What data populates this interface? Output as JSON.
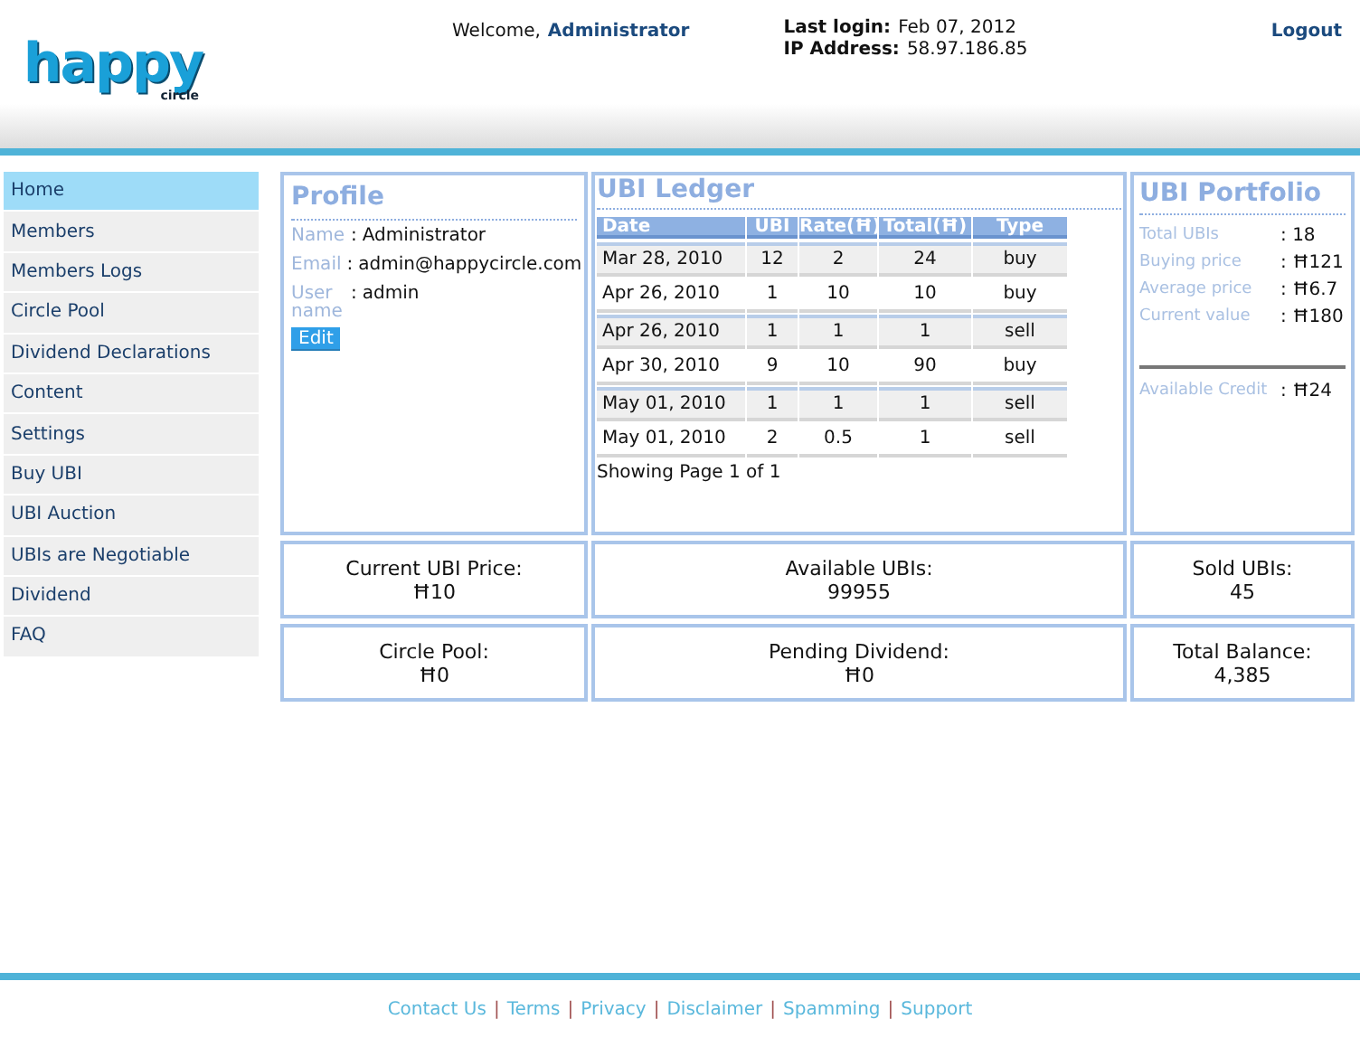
{
  "logo": {
    "main": "happy",
    "sub": "circle"
  },
  "header": {
    "welcome_label": "Welcome,",
    "user": "Administrator",
    "last_login_label": "Last login:",
    "last_login": "Feb 07, 2012",
    "ip_label": "IP Address:",
    "ip": "58.97.186.85",
    "logout": "Logout"
  },
  "sidebar": {
    "items": [
      {
        "label": "Home",
        "selected": true
      },
      {
        "label": "Members",
        "selected": false
      },
      {
        "label": "Members Logs",
        "selected": false
      },
      {
        "label": "Circle Pool",
        "selected": false
      },
      {
        "label": "Dividend Declarations",
        "selected": false
      },
      {
        "label": "Content",
        "selected": false
      },
      {
        "label": "Settings",
        "selected": false
      },
      {
        "label": "Buy UBI",
        "selected": false
      },
      {
        "label": "UBI Auction",
        "selected": false
      },
      {
        "label": "UBIs are Negotiable",
        "selected": false
      },
      {
        "label": "Dividend",
        "selected": false
      },
      {
        "label": "FAQ",
        "selected": false
      }
    ]
  },
  "profile": {
    "title": "Profile",
    "fields": [
      {
        "label": "Name",
        "value": "Administrator"
      },
      {
        "label": "Email",
        "value": "admin@happycircle.com"
      },
      {
        "label": "User name",
        "value": "admin"
      }
    ],
    "separator": ":",
    "edit_button": "Edit"
  },
  "ledger": {
    "title": "UBI Ledger",
    "columns": [
      "Date",
      "UBI",
      "Rate(Ħ)",
      "Total(Ħ)",
      "Type"
    ],
    "rows": [
      [
        "Mar 28, 2010",
        "12",
        "2",
        "24",
        "buy"
      ],
      [
        "Apr 26, 2010",
        "1",
        "10",
        "10",
        "buy"
      ],
      [
        "Apr 26, 2010",
        "1",
        "1",
        "1",
        "sell"
      ],
      [
        "Apr 30, 2010",
        "9",
        "10",
        "90",
        "buy"
      ],
      [
        "May 01, 2010",
        "1",
        "1",
        "1",
        "sell"
      ],
      [
        "May 01, 2010",
        "2",
        "0.5",
        "1",
        "sell"
      ]
    ],
    "pager": "Showing Page 1 of 1"
  },
  "portfolio": {
    "title": "UBI Portfolio",
    "separator": ":",
    "items": [
      {
        "label": "Total UBIs",
        "value": "18"
      },
      {
        "label": "Buying price",
        "value": "Ħ121"
      },
      {
        "label": "Average price",
        "value": "Ħ6.7"
      },
      {
        "label": "Current value",
        "value": "Ħ180"
      }
    ],
    "credit": {
      "label": "Available Credit",
      "value": "Ħ24"
    }
  },
  "stats": [
    {
      "label": "Current UBI Price:",
      "value": "Ħ10"
    },
    {
      "label": "Available UBIs:",
      "value": "99955"
    },
    {
      "label": "Sold UBIs:",
      "value": "45"
    },
    {
      "label": "Circle Pool:",
      "value": "Ħ0"
    },
    {
      "label": "Pending Dividend:",
      "value": "Ħ0"
    },
    {
      "label": "Total Balance:",
      "value": "4,385"
    }
  ],
  "footer": {
    "separator": "|",
    "links": [
      "Contact Us",
      "Terms",
      "Privacy",
      "Disclaimer",
      "Spamming",
      "Support"
    ]
  }
}
